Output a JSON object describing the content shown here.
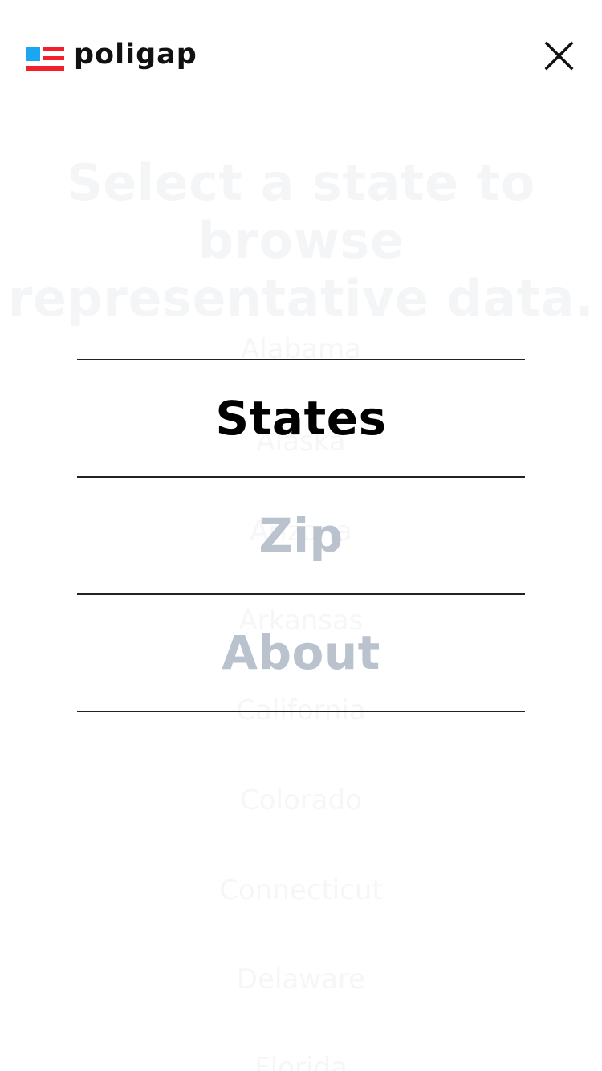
{
  "app": {
    "brand_name": "poligap",
    "colors": {
      "brand_blue": "#1aa6f0",
      "brand_red": "#f2202a",
      "inactive": "#b9c2cd",
      "active": "#000000"
    }
  },
  "header": {
    "close_icon": "close-icon"
  },
  "background": {
    "headline_line1": "Select a state to browse",
    "headline_line2": "representative data.",
    "states": [
      "Alabama",
      "Alaska",
      "Arizona",
      "Arkansas",
      "California",
      "Colorado",
      "Connecticut",
      "Delaware",
      "Florida"
    ]
  },
  "menu": {
    "items": [
      {
        "label": "States",
        "active": true
      },
      {
        "label": "Zip",
        "active": false
      },
      {
        "label": "About",
        "active": false
      }
    ]
  }
}
